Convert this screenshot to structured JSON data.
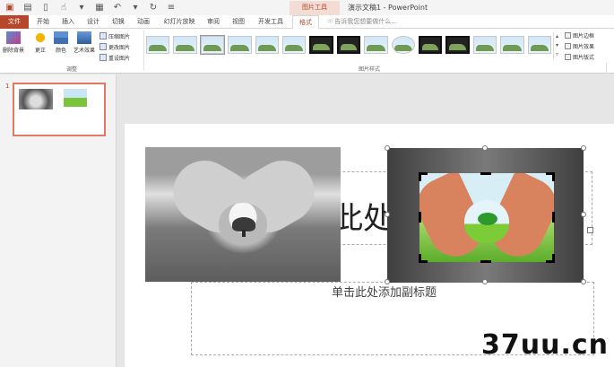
{
  "titlebar": {
    "title": "演示文稿1 - PowerPoint",
    "context_tab_group": "图片工具"
  },
  "tabs": [
    {
      "label": "文件"
    },
    {
      "label": "开始"
    },
    {
      "label": "插入"
    },
    {
      "label": "设计"
    },
    {
      "label": "切换"
    },
    {
      "label": "动画"
    },
    {
      "label": "幻灯片放映"
    },
    {
      "label": "审阅"
    },
    {
      "label": "视图"
    },
    {
      "label": "开发工具"
    },
    {
      "label": "格式"
    }
  ],
  "tell_me": "告诉我您想要做什么...",
  "ribbon": {
    "remove_bg": "删除背景",
    "corrections": "更正",
    "color": "颜色",
    "artistic": "艺术效果",
    "compress": "压缩图片",
    "change": "更改图片",
    "reset": "重设图片",
    "adjust_group": "调整",
    "styles_group": "图片样式",
    "border": "图片边框",
    "effects": "图片效果",
    "layout": "图片版式"
  },
  "slide_panel": {
    "slide_number": "1"
  },
  "slide": {
    "title_placeholder": "单击此处添加标题",
    "title_visible": "此处添加标题",
    "subtitle_placeholder": "单击此处添加副标题"
  },
  "watermark": "37uu.cn",
  "colors": {
    "accent": "#b7472a",
    "selection": "#e07a5f"
  }
}
